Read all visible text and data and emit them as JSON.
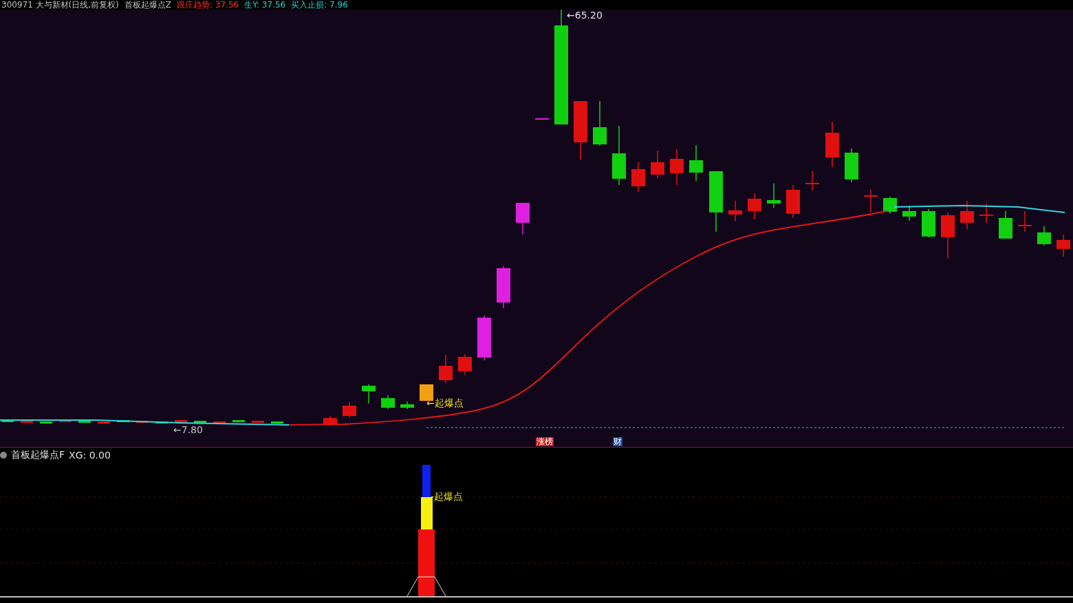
{
  "header": {
    "parts": [
      {
        "text": "300971 大与新材(日线,前复权)",
        "color": "#c0c0c0"
      },
      {
        "text": "首板起爆点Z",
        "color": "#c0c0c0"
      },
      {
        "text": "跟庄趋势: 37.56",
        "color": "#ff3030"
      },
      {
        "text": "生Y: 37.56",
        "color": "#30d0d0"
      },
      {
        "text": "买入止损: 7.96",
        "color": "#30d0d0"
      }
    ]
  },
  "main_chart": {
    "high_label": "←65.20",
    "low_label": "←7.80",
    "signal_label": "←起爆点"
  },
  "tags": [
    {
      "text": "涨榜",
      "color": "#c02020"
    },
    {
      "text": "财",
      "color": "#2050a0"
    }
  ],
  "indicator": {
    "title": "首板起爆点F",
    "reading": "XG: 0.00",
    "signal_label": "-起爆点"
  }
}
